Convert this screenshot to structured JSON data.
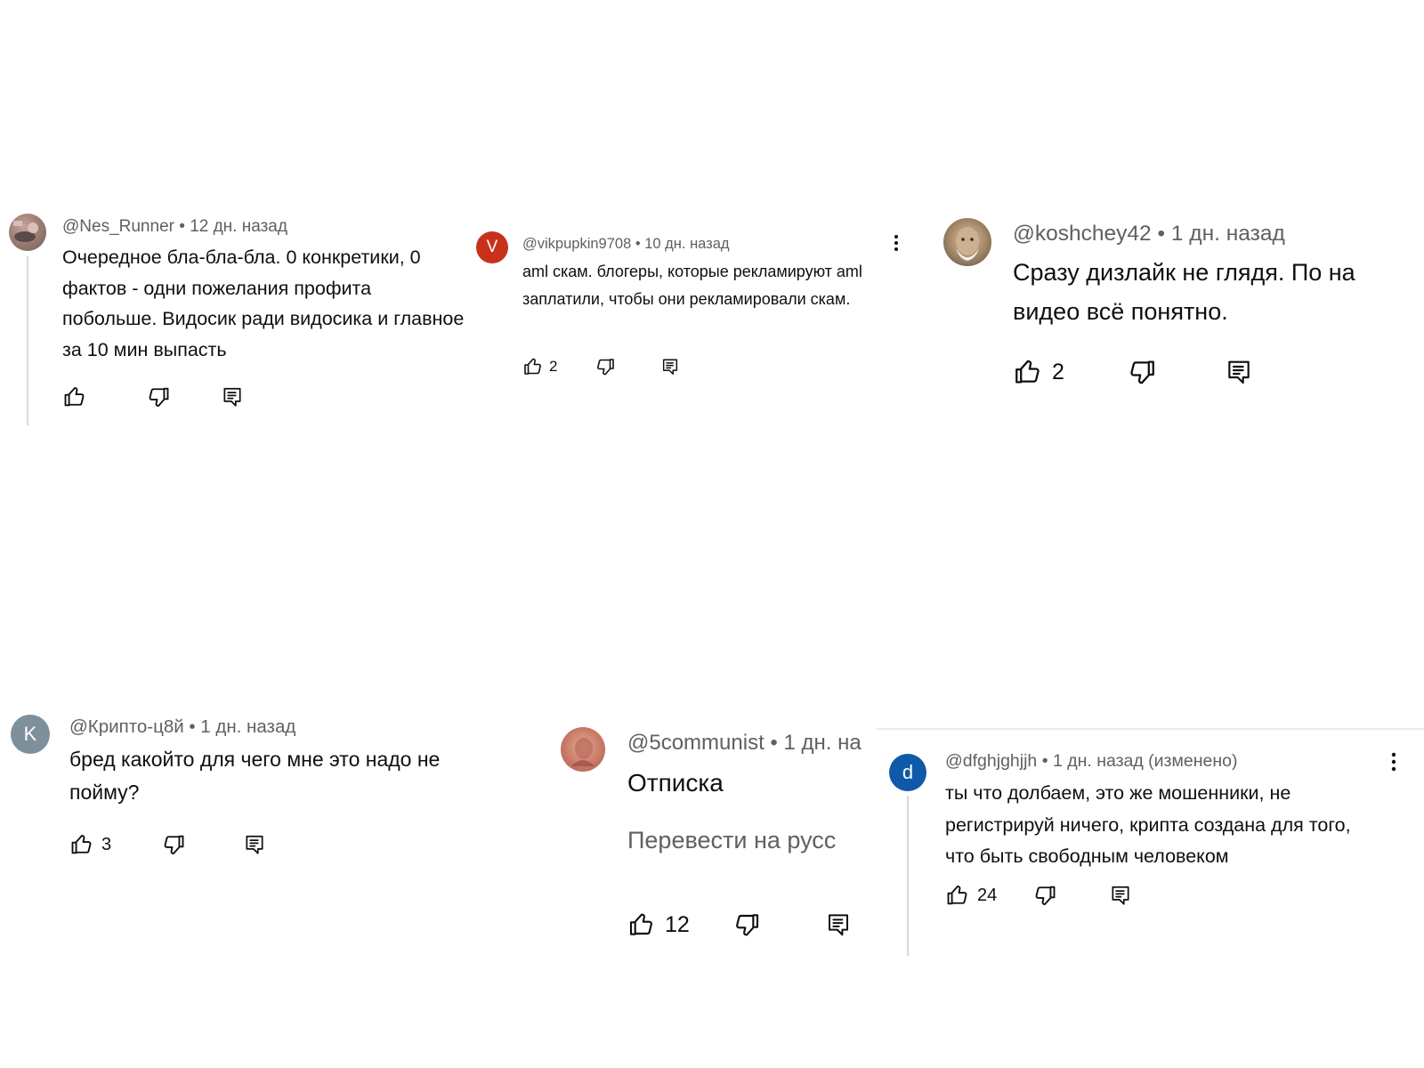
{
  "comments": [
    {
      "author": "@Nes_Runner",
      "time": "12 дн. назад",
      "text": "Очередное бла-бла-бла. 0 конкретики, 0 фактов - одни пожелания профита побольше. Видосик ради видосика и главное за 10 мин выпасть",
      "likes": ""
    },
    {
      "author": "@vikpupkin9708",
      "avatar_letter": "V",
      "time": "10 дн. назад",
      "text": "aml скам. блогеры, которые рекламируют aml заплатили, чтобы они рекламировали скам.",
      "likes": "2"
    },
    {
      "author": "@koshchey42",
      "time": "1 дн. назад",
      "text": "Сразу дизлайк не глядя. По на видео всё понятно.",
      "likes": "2"
    },
    {
      "author": "@Крипто-ц8й",
      "avatar_letter": "K",
      "time": "1 дн. назад",
      "text": "бред какойто для чего мне это надо не пойму?",
      "likes": "3"
    },
    {
      "author": "@5communist",
      "time": "1 дн. на",
      "text": "Отписка",
      "translate": "Перевести на русс",
      "likes": "12"
    },
    {
      "author": "@dfghjghjjh",
      "avatar_letter": "d",
      "time": "1 дн. назад (изменено)",
      "text": "ты что долбаем, это же мошенники, не регистрируй ничего, крипта создана для того, что быть свободным человеком",
      "likes": "24"
    }
  ],
  "colors": {
    "avatar_v": "#c8321c",
    "avatar_k": "#7d909c",
    "avatar_d": "#0f5aa8",
    "text": "#0f0f0f",
    "meta": "#606060"
  },
  "icons": [
    "like-icon",
    "dislike-icon",
    "reply-icon",
    "more-vert-icon"
  ],
  "separator": "•"
}
